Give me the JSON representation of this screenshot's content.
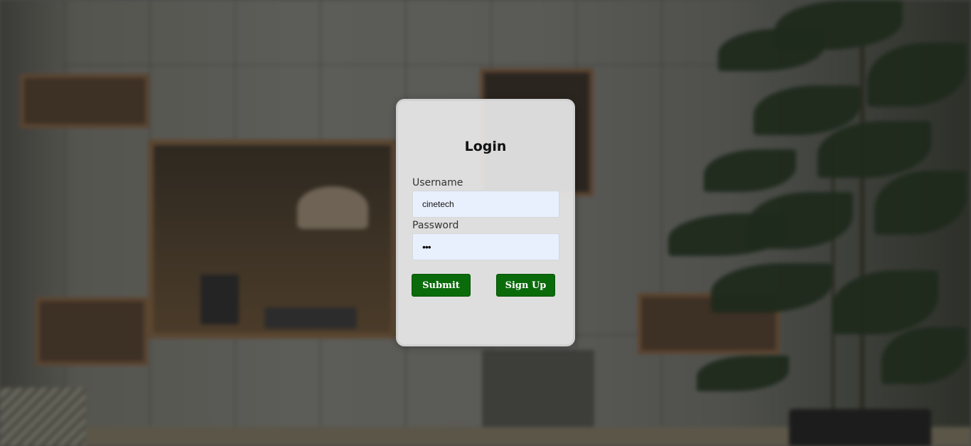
{
  "login": {
    "title": "Login",
    "username_label": "Username",
    "username_value": "cinetech",
    "password_label": "Password",
    "password_masked": "•••",
    "submit_label": "Submit",
    "signup_label": "Sign Up"
  },
  "colors": {
    "button": "#0a6b0a",
    "input_bg": "#e8f0fe",
    "card_bg": "#e8e8e8"
  }
}
